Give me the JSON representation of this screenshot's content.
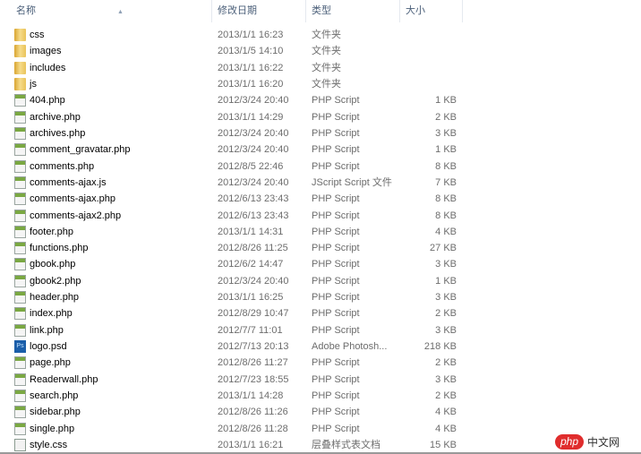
{
  "columns": {
    "name": "名称",
    "date": "修改日期",
    "type": "类型",
    "size": "大小"
  },
  "files": [
    {
      "name": "css",
      "date": "2013/1/1 16:23",
      "type": "文件夹",
      "size": "",
      "icon": "folder"
    },
    {
      "name": "images",
      "date": "2013/1/5 14:10",
      "type": "文件夹",
      "size": "",
      "icon": "folder"
    },
    {
      "name": "includes",
      "date": "2013/1/1 16:22",
      "type": "文件夹",
      "size": "",
      "icon": "folder"
    },
    {
      "name": "js",
      "date": "2013/1/1 16:20",
      "type": "文件夹",
      "size": "",
      "icon": "folder"
    },
    {
      "name": "404.php",
      "date": "2012/3/24 20:40",
      "type": "PHP Script",
      "size": "1 KB",
      "icon": "doc"
    },
    {
      "name": "archive.php",
      "date": "2013/1/1 14:29",
      "type": "PHP Script",
      "size": "2 KB",
      "icon": "doc"
    },
    {
      "name": "archives.php",
      "date": "2012/3/24 20:40",
      "type": "PHP Script",
      "size": "3 KB",
      "icon": "doc"
    },
    {
      "name": "comment_gravatar.php",
      "date": "2012/3/24 20:40",
      "type": "PHP Script",
      "size": "1 KB",
      "icon": "doc"
    },
    {
      "name": "comments.php",
      "date": "2012/8/5 22:46",
      "type": "PHP Script",
      "size": "8 KB",
      "icon": "doc"
    },
    {
      "name": "comments-ajax.js",
      "date": "2012/3/24 20:40",
      "type": "JScript Script 文件",
      "size": "7 KB",
      "icon": "doc"
    },
    {
      "name": "comments-ajax.php",
      "date": "2012/6/13 23:43",
      "type": "PHP Script",
      "size": "8 KB",
      "icon": "doc"
    },
    {
      "name": "comments-ajax2.php",
      "date": "2012/6/13 23:43",
      "type": "PHP Script",
      "size": "8 KB",
      "icon": "doc"
    },
    {
      "name": "footer.php",
      "date": "2013/1/1 14:31",
      "type": "PHP Script",
      "size": "4 KB",
      "icon": "doc"
    },
    {
      "name": "functions.php",
      "date": "2012/8/26 11:25",
      "type": "PHP Script",
      "size": "27 KB",
      "icon": "doc"
    },
    {
      "name": "gbook.php",
      "date": "2012/6/2 14:47",
      "type": "PHP Script",
      "size": "3 KB",
      "icon": "doc"
    },
    {
      "name": "gbook2.php",
      "date": "2012/3/24 20:40",
      "type": "PHP Script",
      "size": "1 KB",
      "icon": "doc"
    },
    {
      "name": "header.php",
      "date": "2013/1/1 16:25",
      "type": "PHP Script",
      "size": "3 KB",
      "icon": "doc"
    },
    {
      "name": "index.php",
      "date": "2012/8/29 10:47",
      "type": "PHP Script",
      "size": "2 KB",
      "icon": "doc"
    },
    {
      "name": "link.php",
      "date": "2012/7/7 11:01",
      "type": "PHP Script",
      "size": "3 KB",
      "icon": "doc"
    },
    {
      "name": "logo.psd",
      "date": "2012/7/13 20:13",
      "type": "Adobe Photosh...",
      "size": "218 KB",
      "icon": "psd"
    },
    {
      "name": "page.php",
      "date": "2012/8/26 11:27",
      "type": "PHP Script",
      "size": "2 KB",
      "icon": "doc"
    },
    {
      "name": "Readerwall.php",
      "date": "2012/7/23 18:55",
      "type": "PHP Script",
      "size": "3 KB",
      "icon": "doc"
    },
    {
      "name": "search.php",
      "date": "2013/1/1 14:28",
      "type": "PHP Script",
      "size": "2 KB",
      "icon": "doc"
    },
    {
      "name": "sidebar.php",
      "date": "2012/8/26 11:26",
      "type": "PHP Script",
      "size": "4 KB",
      "icon": "doc"
    },
    {
      "name": "single.php",
      "date": "2012/8/26 11:28",
      "type": "PHP Script",
      "size": "4 KB",
      "icon": "doc"
    },
    {
      "name": "style.css",
      "date": "2013/1/1 16:21",
      "type": "层叠样式表文档",
      "size": "15 KB",
      "icon": "css"
    }
  ],
  "watermark": {
    "logo": "php",
    "text": "中文网"
  }
}
